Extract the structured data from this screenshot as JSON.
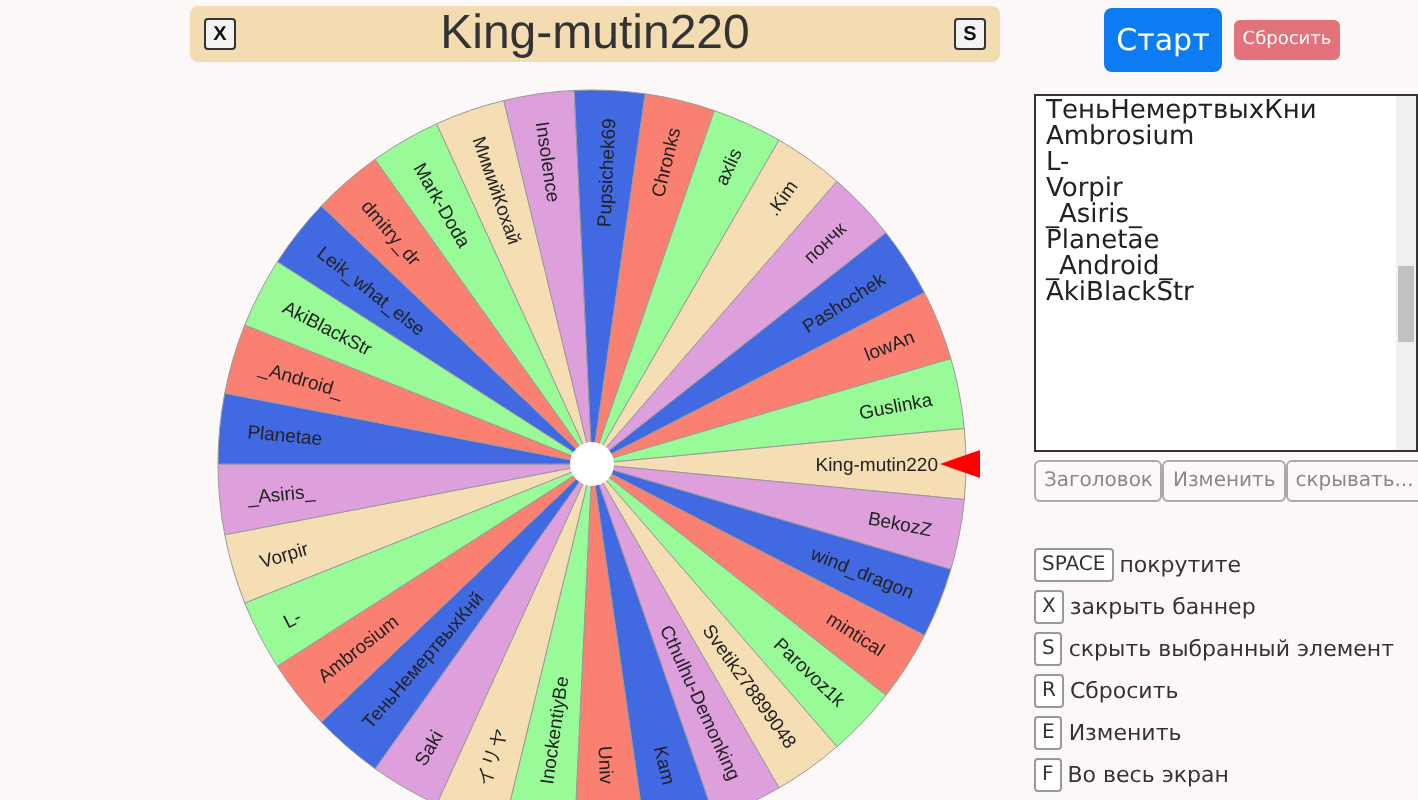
{
  "banner": {
    "title": "King-mutin220",
    "buttons": [
      {
        "label": "X"
      },
      {
        "label": "S"
      }
    ]
  },
  "start_button": "Старт",
  "reset_button": "Сбросить",
  "wheel": {
    "segments": [
      {
        "label": "Leik_what_else"
      },
      {
        "label": "dmitry_dr"
      },
      {
        "label": "Mark-Doda"
      },
      {
        "label": "МимийКохай"
      },
      {
        "label": "Insolence"
      },
      {
        "label": "Pupsichek69"
      },
      {
        "label": "Chronks"
      },
      {
        "label": "axlis"
      },
      {
        "label": ".Kim"
      },
      {
        "label": "пончк"
      },
      {
        "label": "Pashochek"
      },
      {
        "label": "lowAn"
      },
      {
        "label": "Guslinka"
      },
      {
        "label": "King-mutin220"
      },
      {
        "label": "BekozZ"
      },
      {
        "label": "wind_dragon"
      },
      {
        "label": "mintical"
      },
      {
        "label": "Parovoz1k"
      },
      {
        "label": "Svetik278899048"
      },
      {
        "label": "Cthulhu-Demonking"
      },
      {
        "label": "Kam"
      },
      {
        "label": "Univ"
      },
      {
        "label": "InockentiyBe"
      },
      {
        "label": "イリヤ"
      },
      {
        "label": "Saki"
      },
      {
        "label": "ТеньНемертвыхКнй"
      },
      {
        "label": "Ambrosium"
      },
      {
        "label": "L-"
      },
      {
        "label": "Vorpir"
      },
      {
        "label": "_Asiris_"
      },
      {
        "label": "Planetae"
      },
      {
        "label": "_Android_"
      },
      {
        "label": "AkiBlackStr"
      }
    ]
  },
  "names_list": [
    "ТеньНемертвыхКни",
    "Ambrosium",
    "L-",
    "Vorpir",
    "_Asiris_",
    "Planetae",
    "_Android_",
    "AkiBlackStr"
  ],
  "list_buttons": [
    "Заголовок",
    "Изменить",
    "скрывать..."
  ],
  "shortcuts": [
    {
      "key": "SPACE",
      "text": "покрутите"
    },
    {
      "key": "X",
      "text": "закрыть баннер"
    },
    {
      "key": "S",
      "text": "скрыть выбранный элемент"
    },
    {
      "key": "R",
      "text": "Сбросить"
    },
    {
      "key": "E",
      "text": "Изменить"
    },
    {
      "key": "F",
      "text": "Во весь экран"
    }
  ]
}
